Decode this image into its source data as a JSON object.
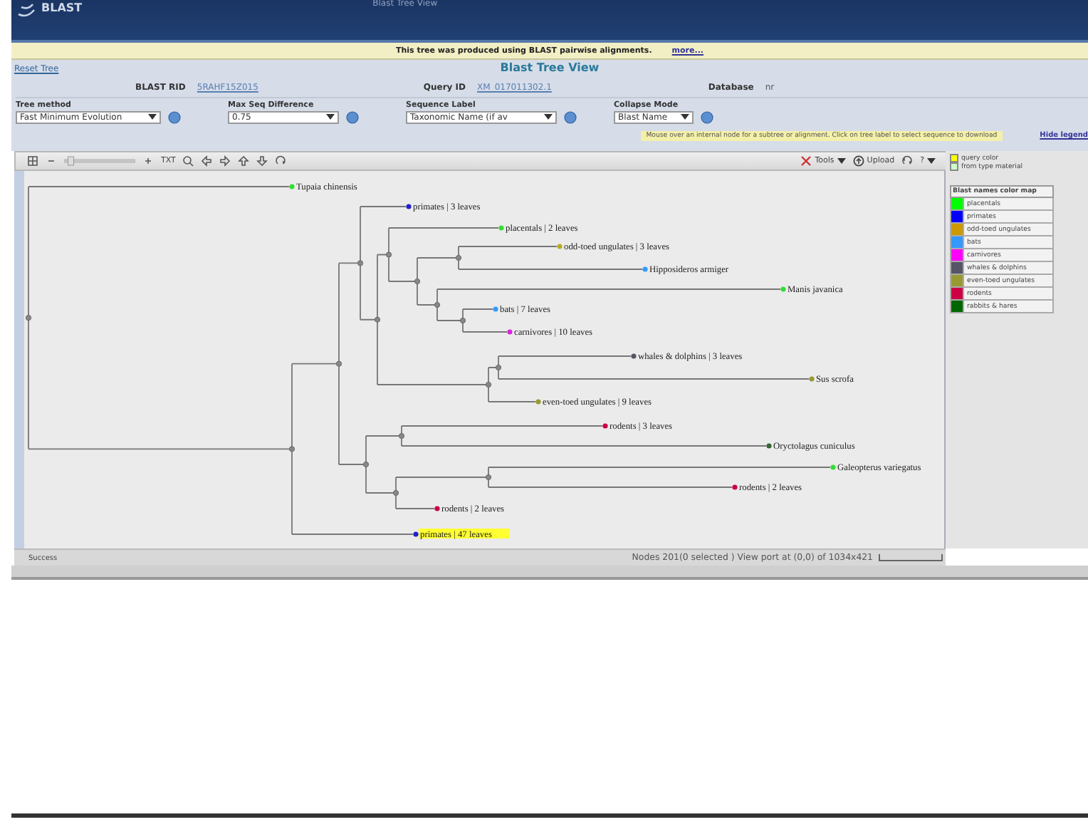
{
  "header": {
    "logo": "BLAST",
    "title": "Blast Tree View"
  },
  "banner": {
    "text": "This tree was produced using BLAST pairwise alignments.",
    "link": "more..."
  },
  "reset_link": "Reset Tree",
  "page_title": "Blast Tree View",
  "info": [
    {
      "label": "BLAST RID",
      "value": "5RAHF15Z015",
      "kind": "link"
    },
    {
      "label": "Query ID",
      "value": "XM_017011302.1",
      "kind": "link"
    },
    {
      "label": "Database",
      "value": "nr",
      "kind": "text"
    }
  ],
  "controls": [
    {
      "label": "Tree method",
      "value": "Fast Minimum Evolution"
    },
    {
      "label": "Max Seq Difference",
      "value": "0.75"
    },
    {
      "label": "Sequence Label",
      "value": "Taxonomic Name (if av"
    },
    {
      "label": "Collapse Mode",
      "value": "Blast Name"
    }
  ],
  "hint": "Mouse over an internal node for a subtree or alignment. Click on tree label to select sequence to download",
  "hide_legend": "Hide legend",
  "toolbar": {
    "zoom": {
      "level": 0.05
    },
    "txt": "TXT",
    "tools": "Tools",
    "upload": "Upload",
    "help": "?"
  },
  "tree": {
    "children": [
      {
        "label": "Tupaia chinensis",
        "color": "#33dd33",
        "highlighted": false
      },
      {
        "children": [
          {
            "children": [
              {
                "children": [
                  {
                    "label": "primates | 3 leaves",
                    "color": "#2222cc",
                    "highlighted": false
                  },
                  {
                    "children": [
                      {
                        "children": [
                          {
                            "label": "placentals | 2 leaves",
                            "color": "#33dd33",
                            "highlighted": false
                          },
                          {
                            "children": [
                              {
                                "children": [
                                  {
                                    "label": "odd-toed ungulates | 3 leaves",
                                    "color": "#bbaa22",
                                    "highlighted": false
                                  },
                                  {
                                    "label": "Hipposideros armiger",
                                    "color": "#3399ff",
                                    "highlighted": false
                                  }
                                ]
                              },
                              {
                                "children": [
                                  {
                                    "label": "Manis javanica",
                                    "color": "#33dd33",
                                    "highlighted": false
                                  },
                                  {
                                    "children": [
                                      {
                                        "label": "bats | 7 leaves",
                                        "color": "#3399ff",
                                        "highlighted": false
                                      },
                                      {
                                        "label": "carnivores | 10 leaves",
                                        "color": "#dd22dd",
                                        "highlighted": false
                                      }
                                    ]
                                  }
                                ]
                              }
                            ]
                          }
                        ]
                      },
                      {
                        "children": [
                          {
                            "children": [
                              {
                                "label": "whales & dolphins | 3 leaves",
                                "color": "#555566",
                                "highlighted": false
                              },
                              {
                                "label": "Sus scrofa",
                                "color": "#999933",
                                "highlighted": false
                              }
                            ]
                          },
                          {
                            "label": "even-toed ungulates | 9 leaves",
                            "color": "#999933",
                            "highlighted": false
                          }
                        ]
                      }
                    ]
                  }
                ]
              },
              {
                "children": [
                  {
                    "children": [
                      {
                        "label": "rodents | 3 leaves",
                        "color": "#cc0044",
                        "highlighted": false
                      },
                      {
                        "label": "Oryctolagus cuniculus",
                        "color": "#336633",
                        "highlighted": false
                      }
                    ]
                  },
                  {
                    "children": [
                      {
                        "children": [
                          {
                            "label": "Galeopterus variegatus",
                            "color": "#33dd33",
                            "highlighted": false
                          },
                          {
                            "label": "rodents | 2 leaves",
                            "color": "#cc0044",
                            "highlighted": false
                          }
                        ]
                      },
                      {
                        "label": "rodents | 2 leaves",
                        "color": "#cc0044",
                        "highlighted": false
                      }
                    ]
                  }
                ]
              }
            ]
          },
          {
            "label": "primates | 47 leaves",
            "color": "#2222cc",
            "highlighted": true
          }
        ]
      }
    ]
  },
  "legend": {
    "query_color": {
      "label": "query color",
      "color": "#ffff00"
    },
    "type_material": {
      "label": "from type material",
      "color": "#ccffcc"
    },
    "title": "Blast names color map",
    "items": [
      {
        "label": "placentals",
        "color": "#00ff00"
      },
      {
        "label": "primates",
        "color": "#0000ff"
      },
      {
        "label": "odd-toed ungulates",
        "color": "#cc9900"
      },
      {
        "label": "bats",
        "color": "#3399ff"
      },
      {
        "label": "carnivores",
        "color": "#ff00ff"
      },
      {
        "label": "whales & dolphins",
        "color": "#555566"
      },
      {
        "label": "even-toed ungulates",
        "color": "#999933"
      },
      {
        "label": "rodents",
        "color": "#cc0044"
      },
      {
        "label": "rabbits & hares",
        "color": "#006600"
      }
    ]
  },
  "status": {
    "message": "Success",
    "nodes": "Nodes 201(0 selected ) View port at (0,0) of 1034x421"
  }
}
